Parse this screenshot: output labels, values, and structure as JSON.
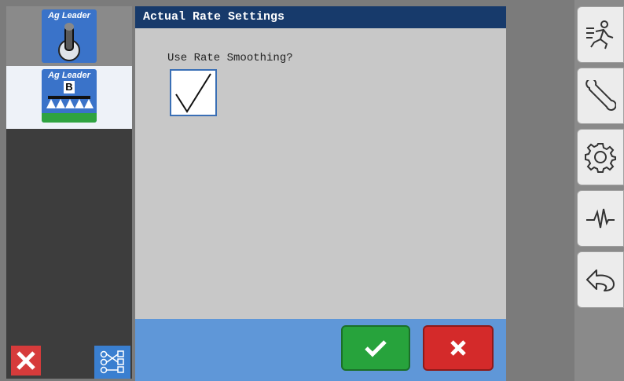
{
  "dialog": {
    "title": "Actual Rate Settings",
    "question": "Use Rate Smoothing?",
    "checked": true
  },
  "apps": [
    {
      "brand": "Ag Leader",
      "icon": "toggle-switch-icon"
    },
    {
      "brand": "Ag Leader",
      "badge": "B",
      "icon": "sprayer-boom-icon"
    }
  ],
  "left_bottom": {
    "close_icon": "close-icon",
    "assign_icon": "function-assignment-icon"
  },
  "toolbar": [
    {
      "icon": "run-icon"
    },
    {
      "icon": "wrench-icon"
    },
    {
      "icon": "gear-icon"
    },
    {
      "icon": "diagnostics-pulse-icon"
    },
    {
      "icon": "back-arrow-icon"
    }
  ],
  "colors": {
    "title_bar": "#173a6b",
    "ok_green": "#27a33c",
    "cancel_red": "#d42a2a",
    "footer_blue": "#5f97d8"
  }
}
